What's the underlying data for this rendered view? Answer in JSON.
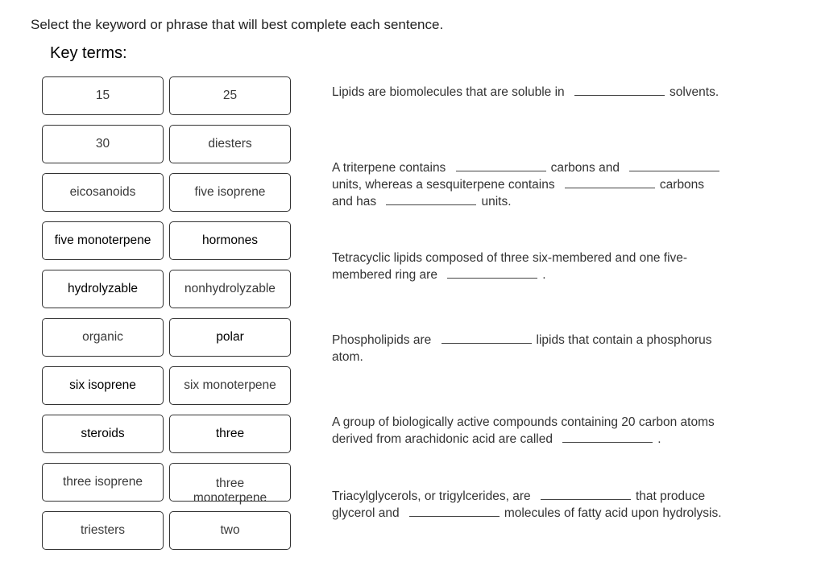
{
  "instruction": "Select the keyword or phrase that will best complete each sentence.",
  "key_terms_title": "Key terms:",
  "terms": [
    {
      "label": "15",
      "dark": false
    },
    {
      "label": "25",
      "dark": false
    },
    {
      "label": "30",
      "dark": false
    },
    {
      "label": "diesters",
      "dark": false
    },
    {
      "label": "eicosanoids",
      "dark": false
    },
    {
      "label": "five isoprene",
      "dark": false
    },
    {
      "label": "five monoterpene",
      "dark": true
    },
    {
      "label": "hormones",
      "dark": true
    },
    {
      "label": "hydrolyzable",
      "dark": true
    },
    {
      "label": "nonhydrolyzable",
      "dark": false
    },
    {
      "label": "organic",
      "dark": false
    },
    {
      "label": "polar",
      "dark": true
    },
    {
      "label": "six isoprene",
      "dark": true
    },
    {
      "label": "six monoterpene",
      "dark": false
    },
    {
      "label": "steroids",
      "dark": true
    },
    {
      "label": "three",
      "dark": true
    },
    {
      "label": "three isoprene",
      "dark": false
    },
    {
      "label": "three monoterpene",
      "dark": false
    },
    {
      "label": "triesters",
      "dark": false
    },
    {
      "label": "two",
      "dark": false
    }
  ],
  "sentences": [
    {
      "parts": [
        "Lipids are biomolecules that are soluble in",
        "_",
        "solvents."
      ]
    },
    {
      "parts": [
        "A triterpene contains",
        "_",
        "carbons and",
        "_",
        "units, whereas a sesquiterpene contains",
        "_",
        "carbons and has",
        "_",
        "units."
      ]
    },
    {
      "parts": [
        "Tetracyclic lipids composed of three six-membered and one five-membered ring are",
        "_",
        "."
      ]
    },
    {
      "parts": [
        "Phospholipids are",
        "_",
        "lipids that contain a phosphorus atom."
      ]
    },
    {
      "parts": [
        "A group of biologically active compounds containing 20 carbon atoms derived from arachidonic acid are called",
        "_",
        "."
      ]
    },
    {
      "parts": [
        "Triacylglycerols, or trigylcerides, are",
        "_",
        "that produce glycerol and",
        "_",
        "molecules of fatty acid upon hydrolysis."
      ]
    }
  ]
}
